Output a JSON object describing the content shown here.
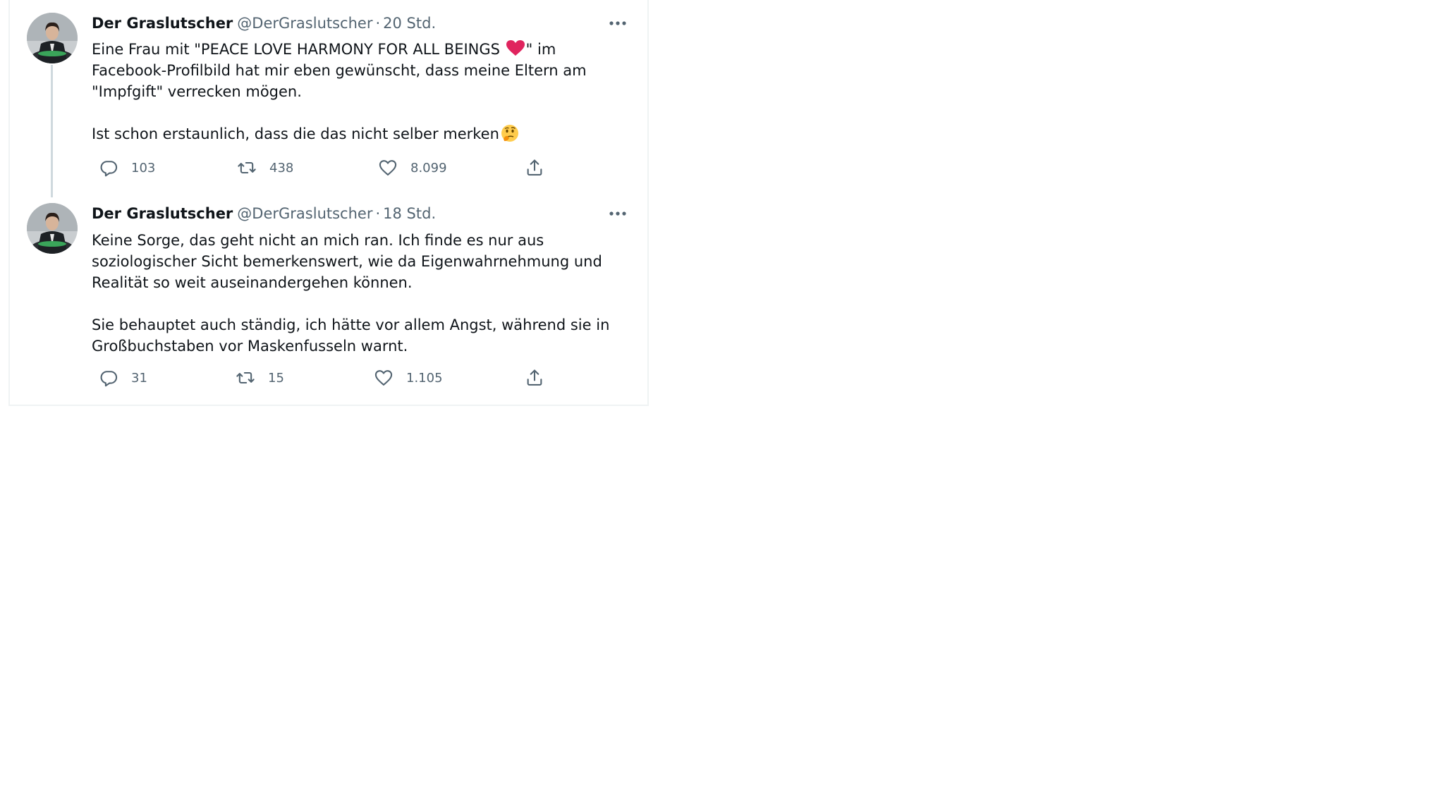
{
  "tweets": [
    {
      "author_name": "Der Graslutscher",
      "handle": "@DerGraslutscher",
      "separator": "·",
      "time": "20 Std.",
      "text_p1_a": "Eine Frau mit \"PEACE LOVE HARMONY FOR ALL BEINGS ",
      "text_p1_b": "\" im Facebook-Profilbild hat mir eben gewünscht, dass meine Eltern am \"Impfgift\" verrecken mögen.",
      "text_p2": "Ist schon erstaunlich, dass die das nicht selber merken",
      "emojis": [
        "red-heart",
        "thinking-face"
      ],
      "reply_count": "103",
      "retweet_count": "438",
      "like_count": "8.099"
    },
    {
      "author_name": "Der Graslutscher",
      "handle": "@DerGraslutscher",
      "separator": "·",
      "time": "18 Std.",
      "text_p1": "Keine Sorge, das geht nicht an mich ran. Ich finde es nur aus soziologischer Sicht bemerkenswert, wie da Eigenwahrnehmung und Realität so weit auseinandergehen können.",
      "text_p2": "Sie behauptet auch ständig, ich hätte vor allem Angst, während sie in Großbuchstaben vor Maskenfusseln warnt.",
      "reply_count": "31",
      "retweet_count": "15",
      "like_count": "1.105"
    }
  ],
  "colors": {
    "text": "#0f1419",
    "secondary": "#536471",
    "border": "#eff3f4",
    "thread_line": "#cfd9de",
    "heart": "#e0245e"
  }
}
